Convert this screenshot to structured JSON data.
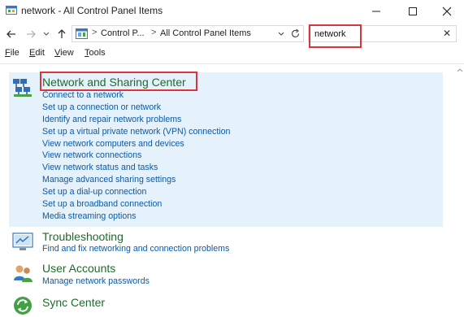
{
  "window": {
    "title": "network - All Control Panel Items",
    "controls": [
      "minimize",
      "maximize",
      "close"
    ]
  },
  "address": {
    "breadcrumbs": [
      "Control P...",
      "All Control Panel Items"
    ],
    "separator": ">"
  },
  "search": {
    "value": "network"
  },
  "menu": {
    "file": {
      "key": "F",
      "rest": "ile"
    },
    "edit": {
      "key": "E",
      "rest": "dit"
    },
    "view": {
      "key": "V",
      "rest": "iew"
    },
    "tools": {
      "key": "T",
      "rest": "ools"
    }
  },
  "results": [
    {
      "title": "Network and Sharing Center",
      "icon": "network-sharing-icon",
      "tasks": [
        "Connect to a network",
        "Set up a connection or network",
        "Identify and repair network problems",
        "Set up a virtual private network (VPN) connection",
        "View network computers and devices",
        "View network connections",
        "View network status and tasks",
        "Manage advanced sharing settings",
        "Set up a dial-up connection",
        "Set up a broadband connection",
        "Media streaming options"
      ]
    },
    {
      "title": "Troubleshooting",
      "icon": "troubleshooting-icon",
      "tasks": [
        "Find and fix networking and connection problems"
      ]
    },
    {
      "title": "User Accounts",
      "icon": "user-accounts-icon",
      "tasks": [
        "Manage network passwords"
      ]
    },
    {
      "title": "Sync Center",
      "icon": "sync-center-icon",
      "tasks": []
    }
  ],
  "colors": {
    "highlight_bg": "#e5f1fb",
    "title_green": "#1f6b2b",
    "link_blue": "#0b5aa8",
    "annotation_red": "#d6363c"
  }
}
